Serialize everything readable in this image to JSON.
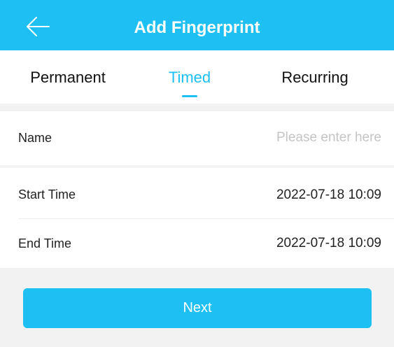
{
  "header": {
    "title": "Add Fingerprint",
    "back_icon": "arrow-left-icon"
  },
  "tabs": [
    {
      "label": "Permanent",
      "active": false
    },
    {
      "label": "Timed",
      "active": true
    },
    {
      "label": "Recurring",
      "active": false
    }
  ],
  "form": {
    "name": {
      "label": "Name",
      "value": "",
      "placeholder": "Please enter here"
    },
    "start_time": {
      "label": "Start Time",
      "value": "2022-07-18 10:09"
    },
    "end_time": {
      "label": "End Time",
      "value": "2022-07-18 10:09"
    }
  },
  "next_button": {
    "label": "Next"
  },
  "colors": {
    "accent": "#1ec0f4",
    "background": "#f2f2f2",
    "placeholder": "#c4c4c4"
  }
}
